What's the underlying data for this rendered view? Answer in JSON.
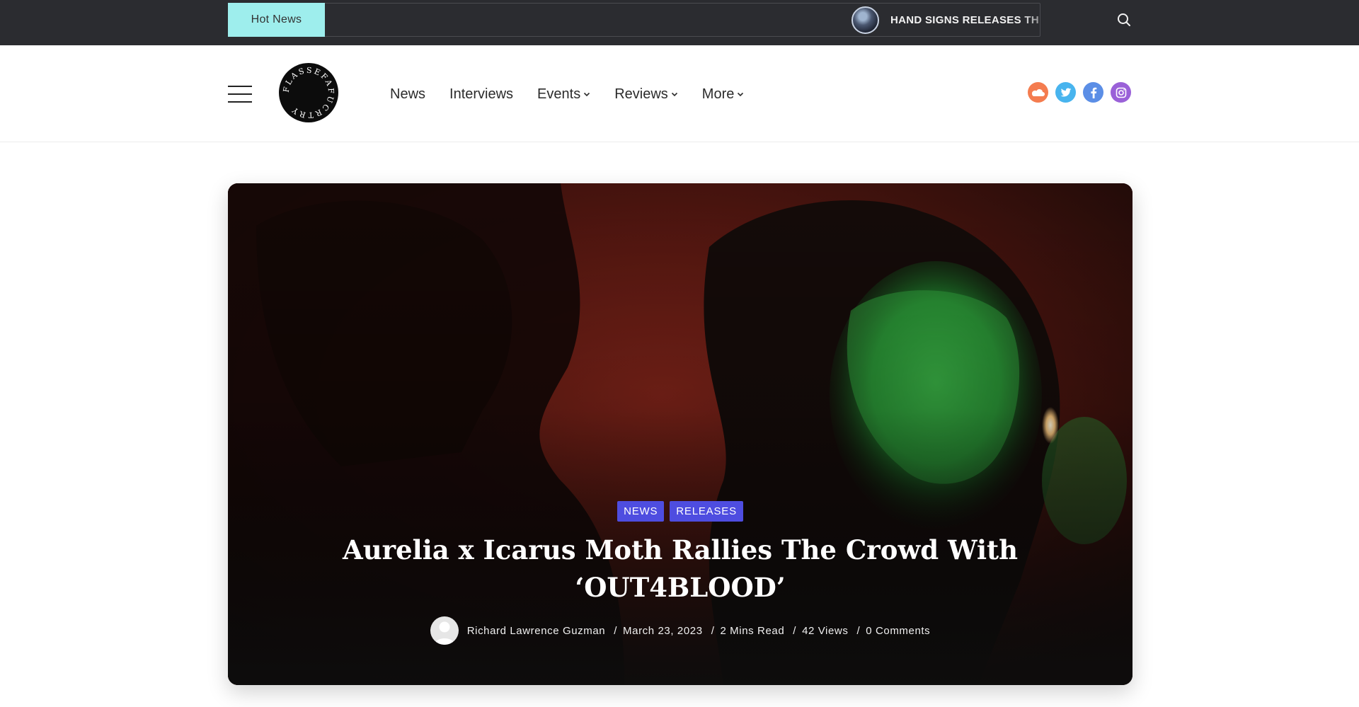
{
  "topbar": {
    "hot_news_label": "Hot News",
    "ticker_text": "HAND SIGNS RELEASES THEIR",
    "colors": {
      "background": "#2b2c30",
      "hot_news_bg": "#9eeeed"
    }
  },
  "header": {
    "logo_text": "FLASSEFAFUCRTRY",
    "nav": [
      {
        "label": "News",
        "has_dropdown": false
      },
      {
        "label": "Interviews",
        "has_dropdown": false
      },
      {
        "label": "Events",
        "has_dropdown": true
      },
      {
        "label": "Reviews",
        "has_dropdown": true
      },
      {
        "label": "More",
        "has_dropdown": true
      }
    ],
    "socials": [
      {
        "icon": "soundcloud-icon",
        "color": "#f47c4f"
      },
      {
        "icon": "twitter-icon",
        "color": "#48b4ee"
      },
      {
        "icon": "facebook-icon",
        "color": "#5b8ee6"
      },
      {
        "icon": "instagram-icon",
        "color": "#9a61d8"
      }
    ]
  },
  "hero": {
    "categories": [
      "NEWS",
      "RELEASES"
    ],
    "title": "Aurelia x Icarus Moth Rallies The Crowd With ‘OUT4BLOOD’",
    "author": "Richard Lawrence Guzman",
    "date": "March 23, 2023",
    "read_time": "2 Mins Read",
    "views": "42 Views",
    "comments": "0 Comments",
    "separator": "/",
    "colors": {
      "category_bg": "#4e4de0"
    }
  }
}
